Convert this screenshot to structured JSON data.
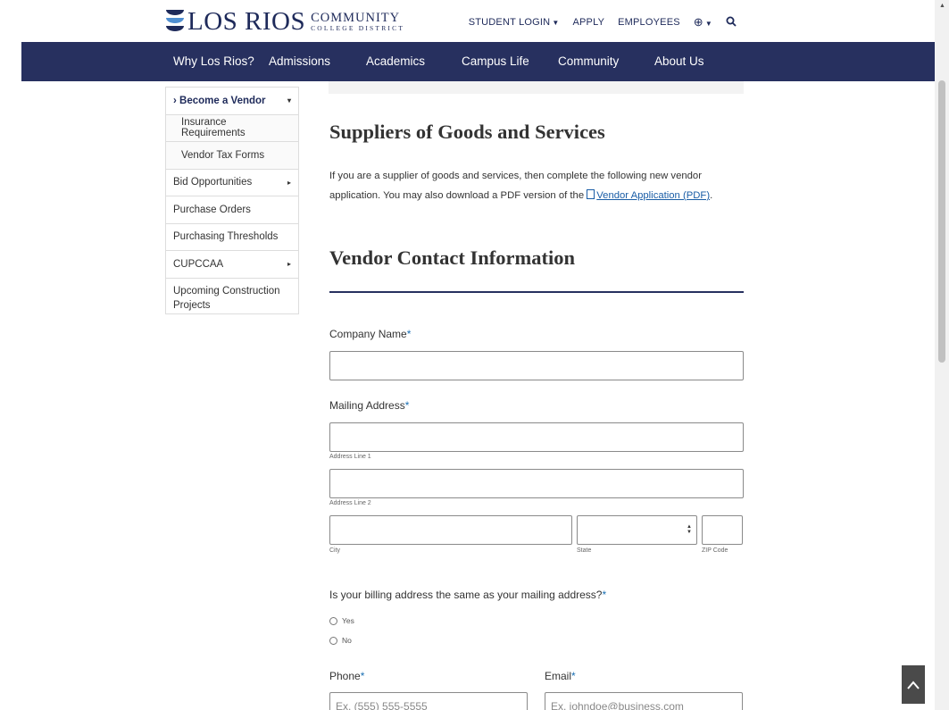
{
  "header": {
    "logo_main": "LOS RIOS",
    "logo_line1": "COMMUNITY",
    "logo_line2": "COLLEGE DISTRICT",
    "utility": {
      "student_login": "STUDENT LOGIN",
      "apply": "APPLY",
      "employees": "EMPLOYEES"
    },
    "colors": {
      "navy": "#27305f",
      "accent": "#1a6fb3"
    }
  },
  "nav": {
    "items": [
      "Why Los Rios?",
      "Admissions",
      "Academics",
      "Campus Life",
      "Community",
      "About Us"
    ]
  },
  "sidebar": {
    "items": [
      {
        "label": "› Become a Vendor",
        "arrow": "▾"
      },
      {
        "label": "Insurance Requirements"
      },
      {
        "label": "Vendor Tax Forms"
      },
      {
        "label": "Bid Opportunities",
        "arrow": "▸"
      },
      {
        "label": "Purchase Orders"
      },
      {
        "label": "Purchasing Thresholds"
      },
      {
        "label": "CUPCCAA",
        "arrow": "▸"
      },
      {
        "label": "Upcoming Construction Projects"
      }
    ]
  },
  "content": {
    "section_title": "Suppliers of Goods and Services",
    "intro_text": "If you are a supplier of goods and services, then complete the following new vendor application. You may also download a PDF version of the",
    "intro_link": "Vendor Application (PDF)",
    "intro_end": ".",
    "form_title": "Vendor Contact Information"
  },
  "form": {
    "required_mark": "*",
    "company_label": "Company Name",
    "mailing_label": "Mailing Address",
    "address_line1": "Address Line 1",
    "address_line2": "Address Line 2",
    "city": "City",
    "state": "State",
    "zip": "ZIP Code",
    "billing_question": "Is your billing address the same as your mailing address?",
    "yes": "Yes",
    "no": "No",
    "phone_label": "Phone",
    "email_label": "Email",
    "phone_placeholder": "Ex. (555) 555-5555",
    "email_placeholder": "Ex. johndoe@business.com"
  },
  "back_to_top": "^"
}
